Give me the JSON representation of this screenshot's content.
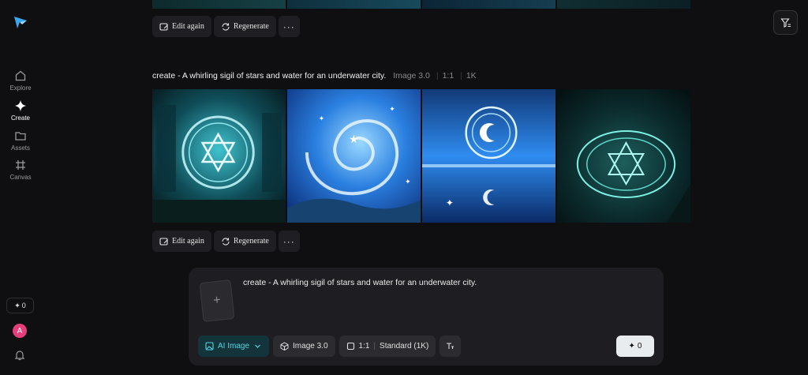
{
  "sidebar": {
    "items": [
      {
        "label": "Explore",
        "icon": "home-icon"
      },
      {
        "label": "Create",
        "icon": "sparkle-icon",
        "active": true
      },
      {
        "label": "Assets",
        "icon": "folder-icon"
      },
      {
        "label": "Canvas",
        "icon": "grid-hash-icon"
      }
    ],
    "credits": "0",
    "avatar_initial": "A"
  },
  "actions": {
    "edit_again": "Edit again",
    "regenerate": "Regenerate",
    "more": "···"
  },
  "generation": {
    "mode": "create",
    "prompt": "A whirling sigil of stars and water for an underwater city.",
    "title": "create - A whirling sigil of stars and water for an underwater city.",
    "model": "Image 3.0",
    "ratio": "1:1",
    "resolution": "1K"
  },
  "composer": {
    "prompt_text": "create - A whirling sigil of stars and water for an underwater city.",
    "mode_label": "AI Image",
    "model_label": "Image 3.0",
    "ratio_label": "1:1",
    "quality_label": "Standard (1K)",
    "send_cost": "0"
  },
  "colors": {
    "background": "#0f0f11",
    "accent": "#4fd6e3",
    "avatar": "#e63d7b"
  }
}
